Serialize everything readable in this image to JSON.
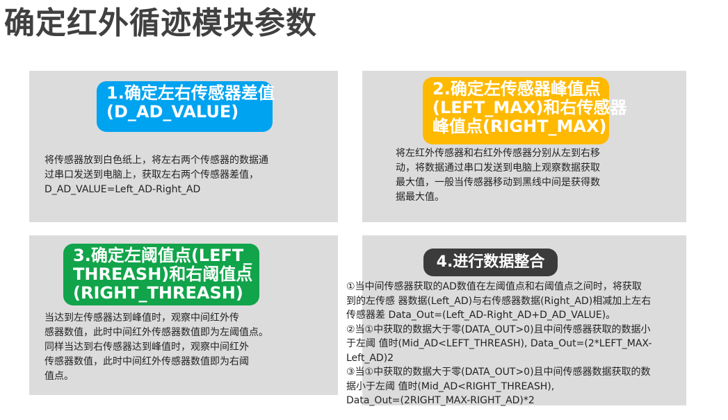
{
  "title": "确定红外循迹模块参数",
  "cards": [
    {
      "badge": [
        "1.确定左右传感器差值",
        "(D_AD_VALUE)"
      ],
      "badge_color": "#00a3f0",
      "desc": [
        "将传感器放到白色纸上，将左右两个传感器的数据通",
        "过串口发送到电脑上，获取左右两个传感器差值，",
        "D_AD_VALUE=Left_AD-Right_AD"
      ]
    },
    {
      "badge": [
        "2.确定左传感器峰值点",
        "(LEFT_MAX)和右传感器",
        "峰值点(RIGHT_MAX)"
      ],
      "badge_color": "#ffb900",
      "desc": [
        "将左红外传感器和右红外传感器分别从左到右移",
        "动，将数据通过串口发送到电脑上观察数据获取",
        "最大值，一般当传感器移动到黑线中间是获得数",
        "据最大值。"
      ]
    },
    {
      "badge": [
        "3.确定左阈值点(LEFT_",
        "THREASH)和右阈值点",
        "(RIGHT_THREASH)"
      ],
      "badge_color": "#11a44a",
      "desc": [
        "当达到左传感器达到峰值时，观察中间红外传",
        "感器数值，此时中间红外传感器数值即为左阈值点。",
        "同样当达到右传感器达到峰值时，观察中间红外",
        "传感器数值，此时中间红外传感器数值即为右阈",
        "值点。"
      ]
    },
    {
      "badge": [
        "4.进行数据整合"
      ],
      "badge_color": "#3b3b3b",
      "desc": [
        "①当中间传感器获取的AD数值在左阈值点和右阈值点之间时，将获取",
        "到的左传感 器数据(Left_AD)与右传感器数据(Right_AD)相减加上左右",
        "传感器差 Data_Out=(Left_AD-Right_AD+D_AD_VALUE)。",
        "②当①中获取的数据大于零(DATA_OUT>0)且中间传感器获取的数据小",
        "于左阈 值时(Mid_AD<LEFT_THREASH), Data_Out=(2*LEFT_MAX-",
        "Left_AD)2",
        "③当①中获取的数据大于零(DATA_OUT>0)且中间传感器数据获取的数",
        "据小于左阈 值时(Mid_AD<RIGHT_THREASH),",
        "Data_Out=(2RIGHT_MAX-RIGHT_AD)*2"
      ]
    }
  ]
}
